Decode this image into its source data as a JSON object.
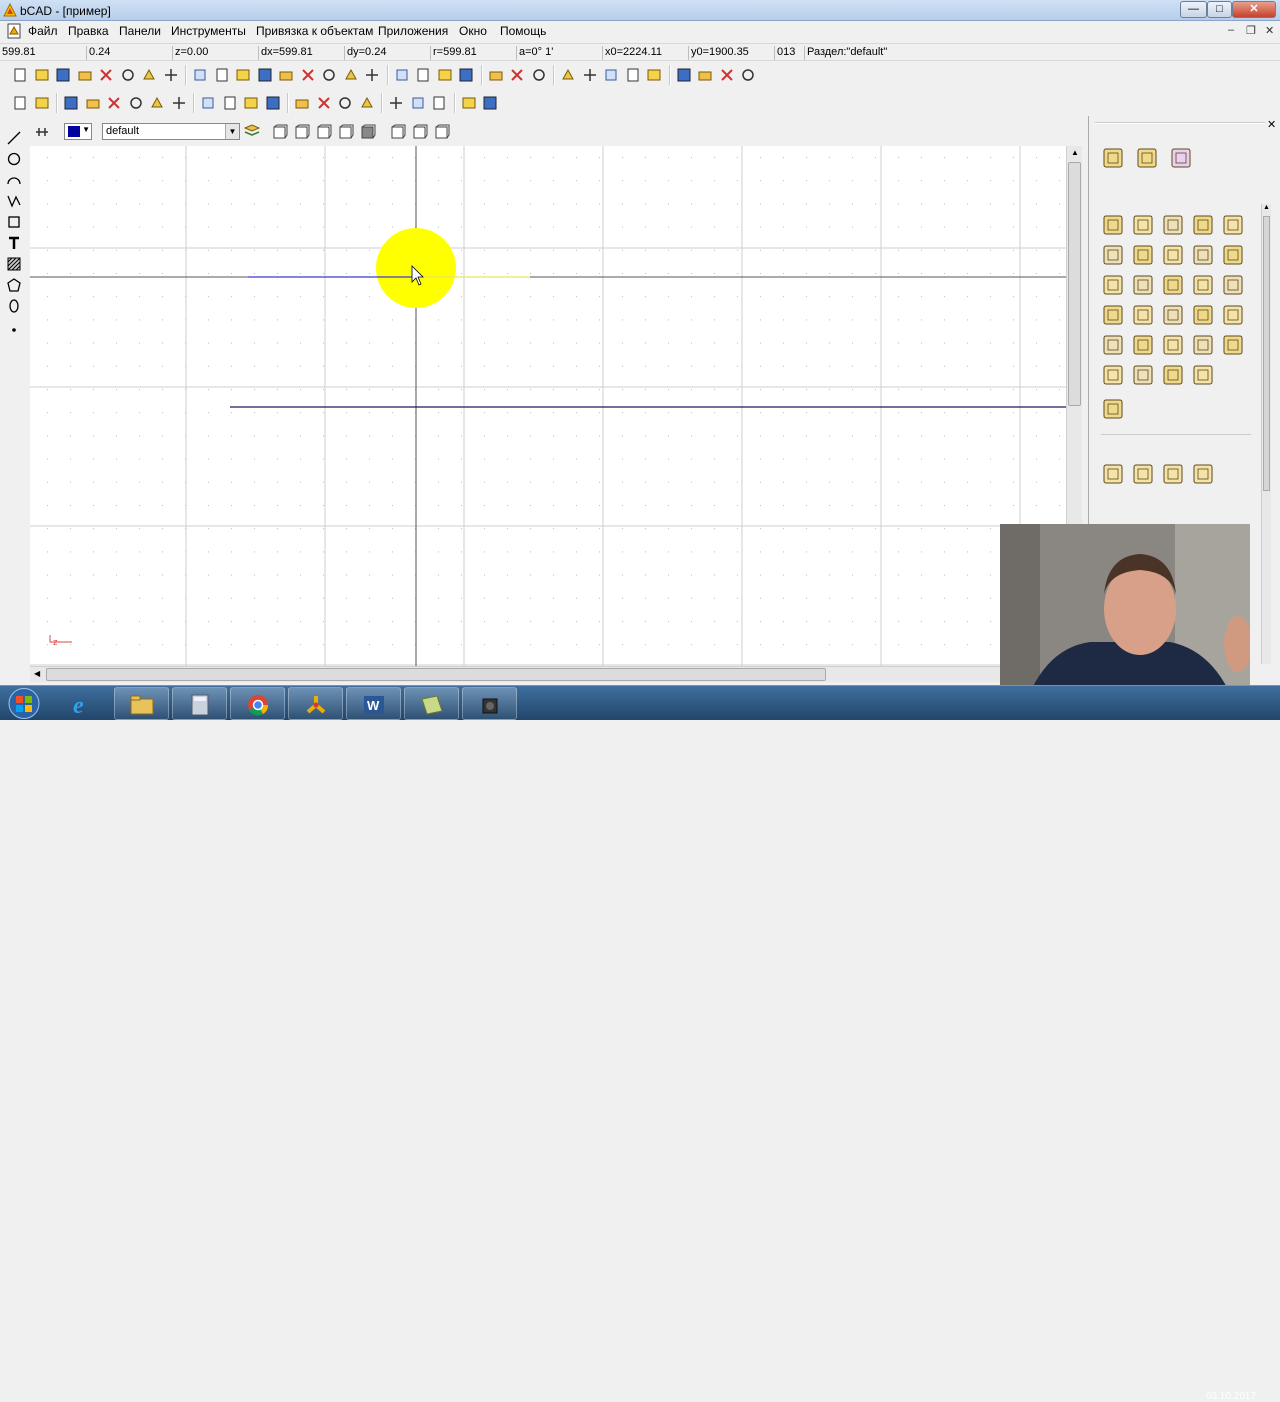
{
  "window": {
    "title": "bCAD - [пример]",
    "buttons": {
      "minimize": "—",
      "maximize": "□",
      "close": "✕"
    }
  },
  "menubar": {
    "items": [
      "Файл",
      "Правка",
      "Панели",
      "Инструменты",
      "Привязка к объектам",
      "Приложения",
      "Окно",
      "Помощь"
    ],
    "mdi_buttons": {
      "minimize": "–",
      "restore": "❐",
      "close": "✕"
    }
  },
  "status": {
    "fields": [
      "599.81",
      "0.24",
      "z=0.00",
      "dx=599.81",
      "dy=0.24",
      "r=599.81",
      "a=0° 1'",
      "x0=2224.11",
      "y0=1900.35",
      "013",
      "Раздел:\"default\""
    ]
  },
  "layer_bar": {
    "color": "#0000a0",
    "layer_name": "default"
  },
  "canvas": {
    "background": "#ffffff",
    "line_color": "#1a1a60",
    "highlight_color": "#ffff00",
    "axis_label": "z"
  },
  "taskbar": {
    "apps": [
      "start-orb",
      "internet-explorer",
      "file-explorer",
      "calculator",
      "chrome",
      "bcad",
      "word",
      "notepad",
      "camera"
    ],
    "clock": "03.10.2017"
  },
  "icons": {
    "toolbar1": [
      "new-icon",
      "new2-icon",
      "image-icon",
      "open-icon",
      "save-icon",
      "save-as-icon",
      "save-all-icon",
      "print-icon",
      "select-icon",
      "delete-icon",
      "transform-icon",
      "erase-icon",
      "copy-icon",
      "paste-icon",
      "filter-icon",
      "undo-icon",
      "redo-icon",
      "snap1-icon",
      "snap2-icon",
      "cross-icon",
      "center-icon",
      "block1-icon",
      "block2-icon",
      "block3-icon",
      "intersect-icon",
      "end-icon",
      "mid-icon",
      "tangent-icon",
      "arc-snap-icon",
      "arc2-icon",
      "circle-snap-icon",
      "circle2-icon",
      "point-icon"
    ],
    "toolbar2": [
      "zoom-in-icon",
      "zoom-out-icon",
      "view1-icon",
      "view2-icon",
      "view3-icon",
      "view4-icon",
      "view5-icon",
      "view6-icon",
      "layers-icon",
      "move-icon",
      "scale-icon",
      "rotate-icon",
      "pen-icon",
      "sun-icon",
      "layers2-icon",
      "layers3-icon",
      "grid-icon",
      "corner-icon",
      "table-icon",
      "pen2-icon",
      "pen3-icon"
    ],
    "left_tools": [
      "line-tool-icon",
      "circle-tool-icon",
      "arc-tool-icon",
      "polyline-tool-icon",
      "rectangle-tool-icon",
      "text-tool-icon",
      "hatch-tool-icon",
      "polygon-tool-icon",
      "ellipse-tool-icon",
      "point-tool-icon"
    ]
  }
}
